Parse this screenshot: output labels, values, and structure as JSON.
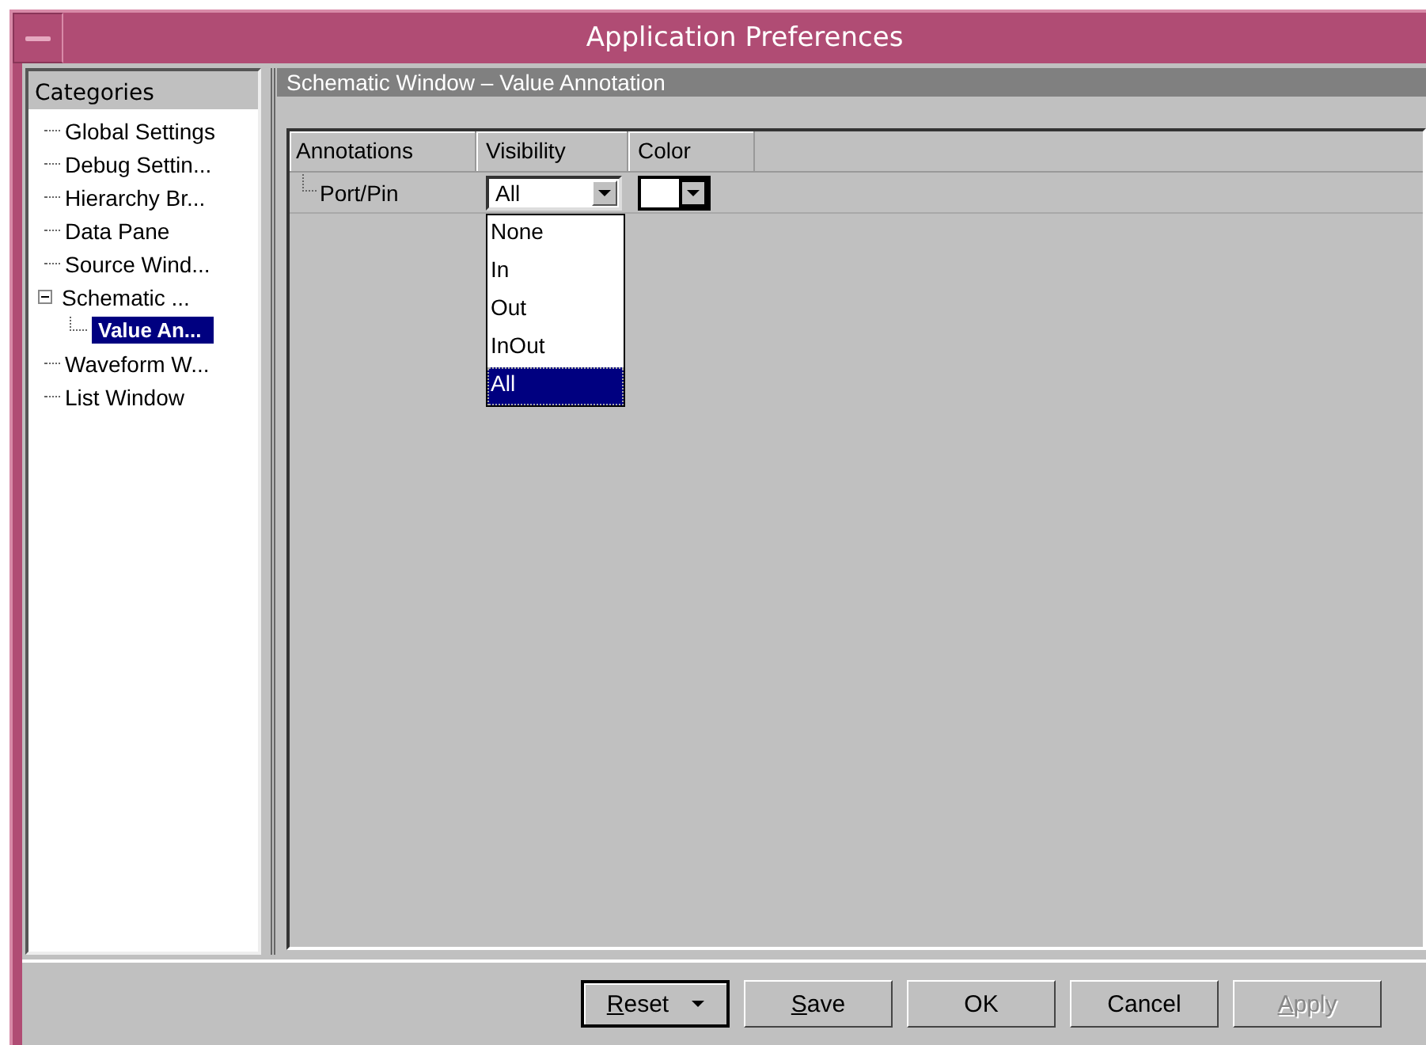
{
  "window": {
    "title": "Application Preferences"
  },
  "categories": {
    "header": "Categories",
    "items": [
      {
        "label": "Global Settings",
        "selected": false
      },
      {
        "label": "Debug Settin...",
        "selected": false
      },
      {
        "label": "Hierarchy Br...",
        "selected": false
      },
      {
        "label": "Data Pane",
        "selected": false
      },
      {
        "label": "Source Wind...",
        "selected": false
      },
      {
        "label": "Schematic ...",
        "selected": false,
        "expanded": true,
        "children": [
          {
            "label": "Value An...",
            "selected": true
          }
        ]
      },
      {
        "label": "Waveform W...",
        "selected": false
      },
      {
        "label": "List Window",
        "selected": false
      }
    ]
  },
  "panel": {
    "title": "Schematic Window – Value Annotation",
    "columns": [
      "Annotations",
      "Visibility",
      "Color"
    ],
    "rows": [
      {
        "name": "Port/Pin",
        "visibility": "All",
        "color": "#ffffff"
      }
    ],
    "dropdown_options": [
      {
        "label": "None",
        "selected": false
      },
      {
        "label": "In",
        "selected": false
      },
      {
        "label": "Out",
        "selected": false
      },
      {
        "label": "InOut",
        "selected": false
      },
      {
        "label": "All",
        "selected": true
      }
    ]
  },
  "buttons": [
    {
      "label": "Reset",
      "default": true,
      "menu": true,
      "mnemonic": true,
      "disabled": false
    },
    {
      "label": "Save",
      "default": false,
      "menu": false,
      "mnemonic": true,
      "disabled": false
    },
    {
      "label": "OK",
      "default": false,
      "menu": false,
      "mnemonic": false,
      "disabled": false
    },
    {
      "label": "Cancel",
      "default": false,
      "menu": false,
      "mnemonic": false,
      "disabled": false
    },
    {
      "label": "Apply",
      "default": false,
      "menu": false,
      "mnemonic": true,
      "disabled": true
    }
  ]
}
